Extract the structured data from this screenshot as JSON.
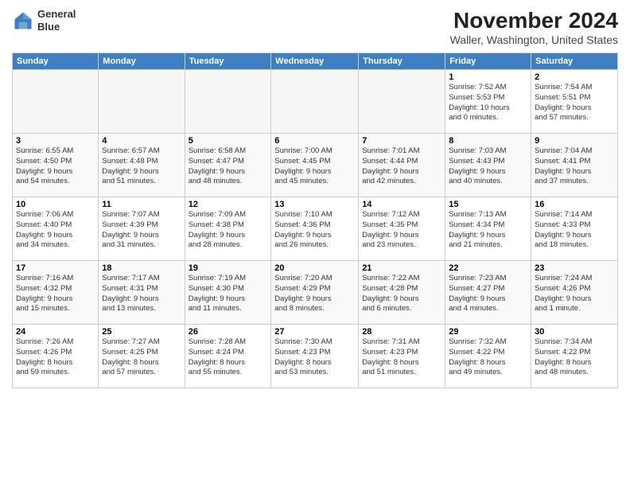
{
  "header": {
    "logo_line1": "General",
    "logo_line2": "Blue",
    "title": "November 2024",
    "subtitle": "Waller, Washington, United States"
  },
  "weekdays": [
    "Sunday",
    "Monday",
    "Tuesday",
    "Wednesday",
    "Thursday",
    "Friday",
    "Saturday"
  ],
  "weeks": [
    [
      {
        "day": "",
        "info": ""
      },
      {
        "day": "",
        "info": ""
      },
      {
        "day": "",
        "info": ""
      },
      {
        "day": "",
        "info": ""
      },
      {
        "day": "",
        "info": ""
      },
      {
        "day": "1",
        "info": "Sunrise: 7:52 AM\nSunset: 5:53 PM\nDaylight: 10 hours\nand 0 minutes."
      },
      {
        "day": "2",
        "info": "Sunrise: 7:54 AM\nSunset: 5:51 PM\nDaylight: 9 hours\nand 57 minutes."
      }
    ],
    [
      {
        "day": "3",
        "info": "Sunrise: 6:55 AM\nSunset: 4:50 PM\nDaylight: 9 hours\nand 54 minutes."
      },
      {
        "day": "4",
        "info": "Sunrise: 6:57 AM\nSunset: 4:48 PM\nDaylight: 9 hours\nand 51 minutes."
      },
      {
        "day": "5",
        "info": "Sunrise: 6:58 AM\nSunset: 4:47 PM\nDaylight: 9 hours\nand 48 minutes."
      },
      {
        "day": "6",
        "info": "Sunrise: 7:00 AM\nSunset: 4:45 PM\nDaylight: 9 hours\nand 45 minutes."
      },
      {
        "day": "7",
        "info": "Sunrise: 7:01 AM\nSunset: 4:44 PM\nDaylight: 9 hours\nand 42 minutes."
      },
      {
        "day": "8",
        "info": "Sunrise: 7:03 AM\nSunset: 4:43 PM\nDaylight: 9 hours\nand 40 minutes."
      },
      {
        "day": "9",
        "info": "Sunrise: 7:04 AM\nSunset: 4:41 PM\nDaylight: 9 hours\nand 37 minutes."
      }
    ],
    [
      {
        "day": "10",
        "info": "Sunrise: 7:06 AM\nSunset: 4:40 PM\nDaylight: 9 hours\nand 34 minutes."
      },
      {
        "day": "11",
        "info": "Sunrise: 7:07 AM\nSunset: 4:39 PM\nDaylight: 9 hours\nand 31 minutes."
      },
      {
        "day": "12",
        "info": "Sunrise: 7:09 AM\nSunset: 4:38 PM\nDaylight: 9 hours\nand 28 minutes."
      },
      {
        "day": "13",
        "info": "Sunrise: 7:10 AM\nSunset: 4:36 PM\nDaylight: 9 hours\nand 26 minutes."
      },
      {
        "day": "14",
        "info": "Sunrise: 7:12 AM\nSunset: 4:35 PM\nDaylight: 9 hours\nand 23 minutes."
      },
      {
        "day": "15",
        "info": "Sunrise: 7:13 AM\nSunset: 4:34 PM\nDaylight: 9 hours\nand 21 minutes."
      },
      {
        "day": "16",
        "info": "Sunrise: 7:14 AM\nSunset: 4:33 PM\nDaylight: 9 hours\nand 18 minutes."
      }
    ],
    [
      {
        "day": "17",
        "info": "Sunrise: 7:16 AM\nSunset: 4:32 PM\nDaylight: 9 hours\nand 15 minutes."
      },
      {
        "day": "18",
        "info": "Sunrise: 7:17 AM\nSunset: 4:31 PM\nDaylight: 9 hours\nand 13 minutes."
      },
      {
        "day": "19",
        "info": "Sunrise: 7:19 AM\nSunset: 4:30 PM\nDaylight: 9 hours\nand 11 minutes."
      },
      {
        "day": "20",
        "info": "Sunrise: 7:20 AM\nSunset: 4:29 PM\nDaylight: 9 hours\nand 8 minutes."
      },
      {
        "day": "21",
        "info": "Sunrise: 7:22 AM\nSunset: 4:28 PM\nDaylight: 9 hours\nand 6 minutes."
      },
      {
        "day": "22",
        "info": "Sunrise: 7:23 AM\nSunset: 4:27 PM\nDaylight: 9 hours\nand 4 minutes."
      },
      {
        "day": "23",
        "info": "Sunrise: 7:24 AM\nSunset: 4:26 PM\nDaylight: 9 hours\nand 1 minute."
      }
    ],
    [
      {
        "day": "24",
        "info": "Sunrise: 7:26 AM\nSunset: 4:26 PM\nDaylight: 8 hours\nand 59 minutes."
      },
      {
        "day": "25",
        "info": "Sunrise: 7:27 AM\nSunset: 4:25 PM\nDaylight: 8 hours\nand 57 minutes."
      },
      {
        "day": "26",
        "info": "Sunrise: 7:28 AM\nSunset: 4:24 PM\nDaylight: 8 hours\nand 55 minutes."
      },
      {
        "day": "27",
        "info": "Sunrise: 7:30 AM\nSunset: 4:23 PM\nDaylight: 8 hours\nand 53 minutes."
      },
      {
        "day": "28",
        "info": "Sunrise: 7:31 AM\nSunset: 4:23 PM\nDaylight: 8 hours\nand 51 minutes."
      },
      {
        "day": "29",
        "info": "Sunrise: 7:32 AM\nSunset: 4:22 PM\nDaylight: 8 hours\nand 49 minutes."
      },
      {
        "day": "30",
        "info": "Sunrise: 7:34 AM\nSunset: 4:22 PM\nDaylight: 8 hours\nand 48 minutes."
      }
    ]
  ],
  "colors": {
    "header_bg": "#3d7fc1",
    "header_text": "#ffffff",
    "accent": "#3d7fc1"
  }
}
